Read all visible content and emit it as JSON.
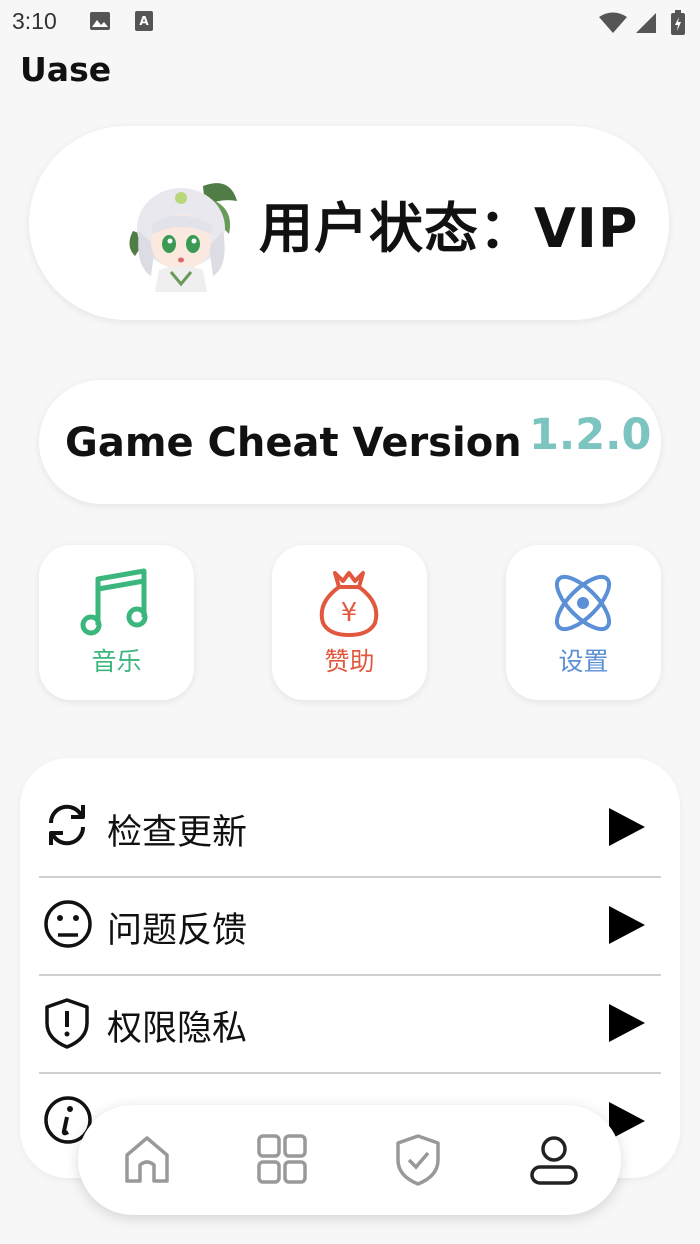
{
  "status_bar": {
    "time": "3:10",
    "icons": [
      "image-icon",
      "a-text-icon",
      "wifi-icon",
      "signal-icon",
      "battery-icon"
    ]
  },
  "app": {
    "title": "Uase"
  },
  "user_card": {
    "avatar": "anime-avatar",
    "status_text": "用户状态：VIP"
  },
  "version_card": {
    "label": "Game Cheat Version",
    "version": "1.2.0"
  },
  "quick_actions": [
    {
      "label": "音乐",
      "icon": "music-note-icon",
      "color": "#3bb77e"
    },
    {
      "label": "赞助",
      "icon": "money-bag-icon",
      "color": "#e2583e"
    },
    {
      "label": "设置",
      "icon": "atom-icon",
      "color": "#5b8fd6"
    }
  ],
  "menu": {
    "items": [
      {
        "label": "检查更新",
        "icon": "refresh-icon"
      },
      {
        "label": "问题反馈",
        "icon": "sad-face-icon"
      },
      {
        "label": "权限隐私",
        "icon": "shield-alert-icon"
      },
      {
        "label": "",
        "icon": "info-icon"
      }
    ]
  },
  "bottom_nav": {
    "items": [
      {
        "icon": "home-icon"
      },
      {
        "icon": "grid-icon"
      },
      {
        "icon": "shield-check-icon"
      },
      {
        "icon": "user-icon"
      }
    ]
  }
}
